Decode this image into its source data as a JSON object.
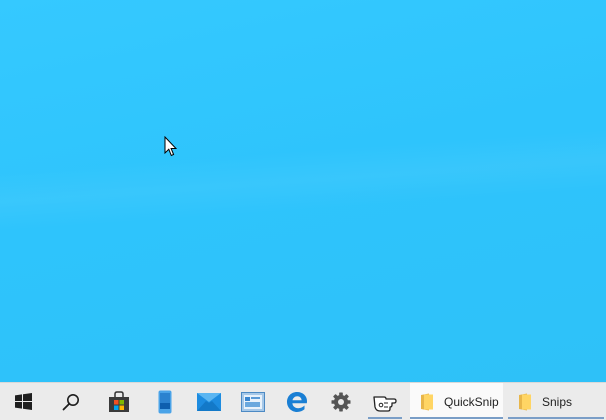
{
  "desktop": {
    "background_color": "#2ec4fc"
  },
  "taskbar": {
    "pinned": [
      {
        "id": "start",
        "icon": "windows-logo-icon"
      },
      {
        "id": "search",
        "icon": "search-icon"
      },
      {
        "id": "store",
        "icon": "store-bag-icon"
      },
      {
        "id": "phone",
        "icon": "phone-icon"
      },
      {
        "id": "mail",
        "icon": "mail-icon"
      },
      {
        "id": "photos",
        "icon": "photos-icon"
      },
      {
        "id": "edge",
        "icon": "edge-icon"
      },
      {
        "id": "settings",
        "icon": "gear-icon"
      },
      {
        "id": "snip",
        "icon": "snip-hand-icon"
      }
    ],
    "windows": [
      {
        "label": "QuickSnip",
        "icon": "folder-icon"
      },
      {
        "label": "Snips",
        "icon": "folder-icon"
      }
    ]
  }
}
